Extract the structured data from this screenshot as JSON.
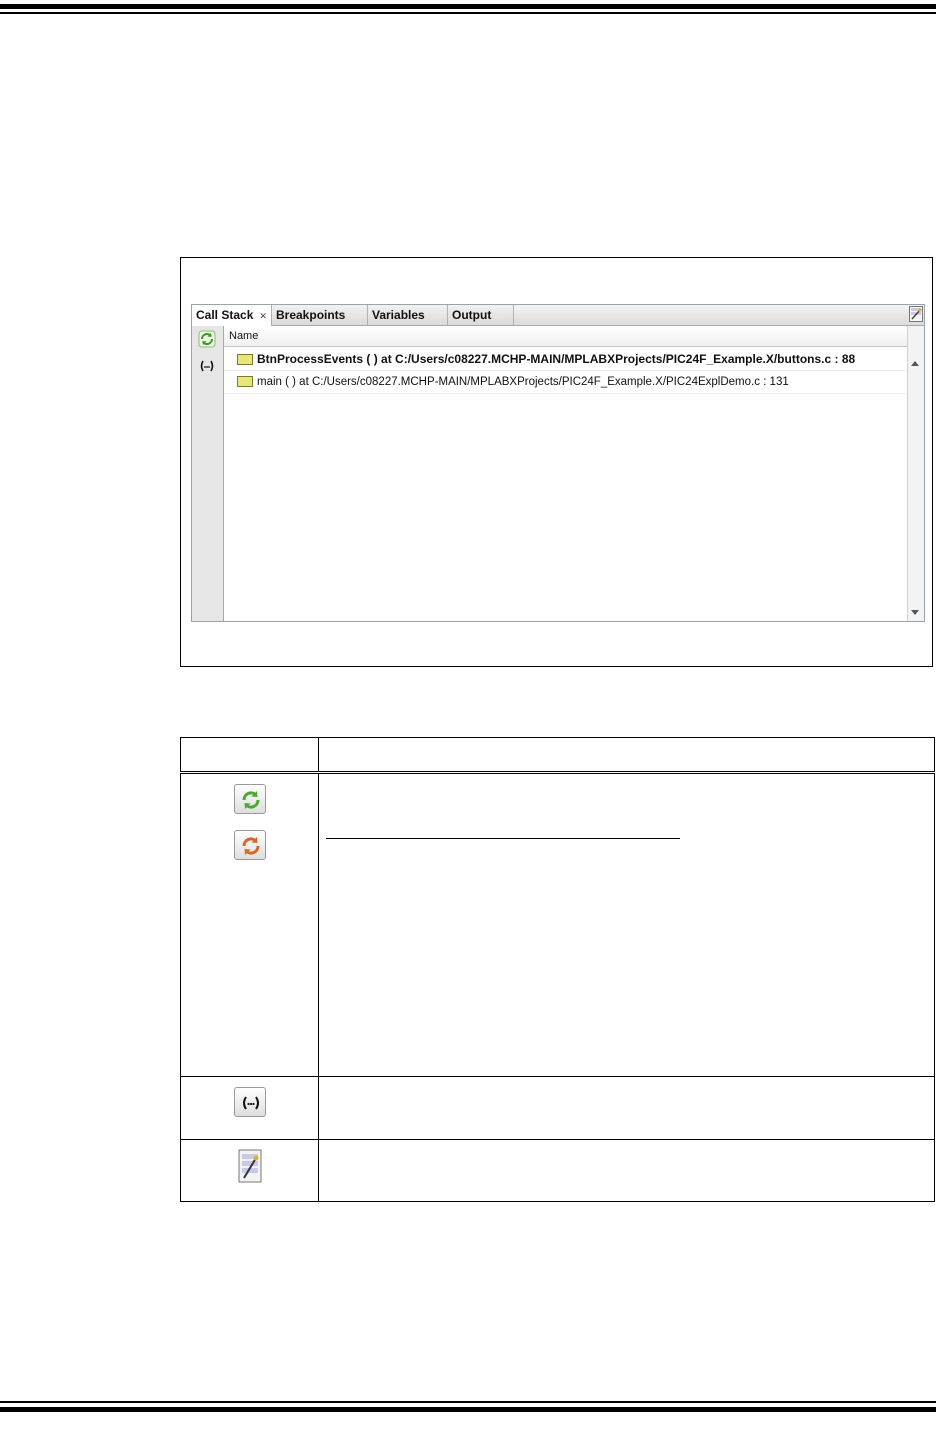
{
  "window": {
    "tabs": [
      {
        "label": "Call Stack",
        "active": true
      },
      {
        "label": "Breakpoints",
        "active": false
      },
      {
        "label": "Variables",
        "active": false
      },
      {
        "label": "Output",
        "active": false
      }
    ],
    "column_header": "Name",
    "rows": [
      {
        "label": "BtnProcessEvents ( )  at  C:/Users/c08227.MCHP-MAIN/MPLABXProjects/PIC24F_Example.X/buttons.c : 88",
        "current": true
      },
      {
        "label": "main ( )  at  C:/Users/c08227.MCHP-MAIN/MPLABXProjects/PIC24F_Example.X/PIC24ExplDemo.c : 131",
        "current": false
      }
    ]
  },
  "icons": {
    "refresh_green": "refresh-icon",
    "refresh_orange": "refresh-icon",
    "expression": "expression-icon",
    "column_selector": "column-selector-icon"
  },
  "colors": {
    "frame_marker": "#e8e67a",
    "refresh_green": "#4caa2c",
    "refresh_orange": "#d8662a"
  }
}
